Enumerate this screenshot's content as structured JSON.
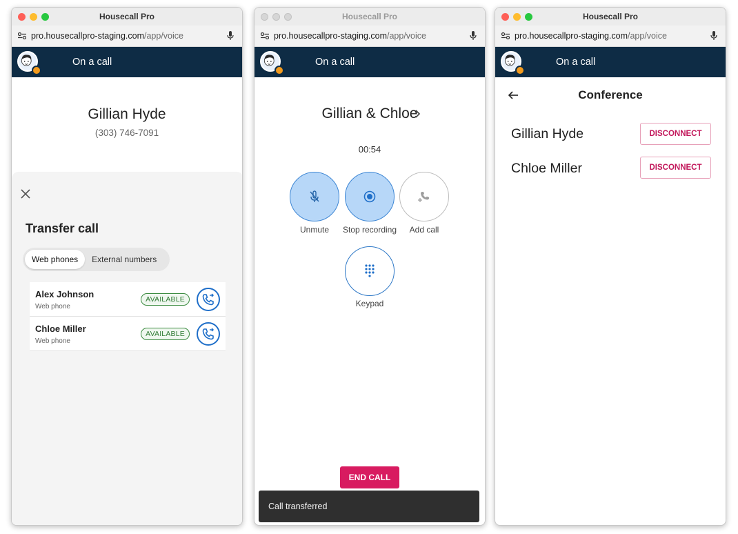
{
  "browser": {
    "title": "Housecall Pro",
    "url_main": "pro.housecallpro-staging.com",
    "url_path": "/app/voice"
  },
  "callbar": {
    "title": "On a call"
  },
  "transfer_screen": {
    "contact_name": "Gillian Hyde",
    "contact_phone": "(303) 746-7091",
    "sheet_title": "Transfer call",
    "tabs": [
      {
        "label": "Web phones",
        "active": true
      },
      {
        "label": "External numbers",
        "active": false
      }
    ],
    "contacts": [
      {
        "name": "Alex Johnson",
        "type": "Web phone",
        "status": "AVAILABLE"
      },
      {
        "name": "Chloe Miller",
        "type": "Web phone",
        "status": "AVAILABLE"
      }
    ]
  },
  "call_screen": {
    "title": "Gillian & Chloe",
    "timer": "00:54",
    "controls": {
      "mute": "Unmute",
      "record": "Stop recording",
      "add": "Add call",
      "keypad": "Keypad"
    },
    "end_call": "END CALL",
    "toast": "Call transferred"
  },
  "conference_screen": {
    "title": "Conference",
    "participants": [
      {
        "name": "Gillian Hyde",
        "action": "DISCONNECT"
      },
      {
        "name": "Chloe Miller",
        "action": "DISCONNECT"
      }
    ]
  },
  "colors": {
    "navy": "#0e2c45",
    "accent_blue": "#1f6fc9",
    "end_call": "#d81b60",
    "available_green": "#2e7a33",
    "status_orange": "#f29a1d"
  },
  "icons": [
    "close-icon",
    "phone-transfer-icon",
    "mic-off-icon",
    "record-icon",
    "add-call-icon",
    "keypad-icon",
    "chevron-right-icon",
    "arrow-back-icon",
    "microphone-icon",
    "site-settings-icon",
    "avatar"
  ]
}
